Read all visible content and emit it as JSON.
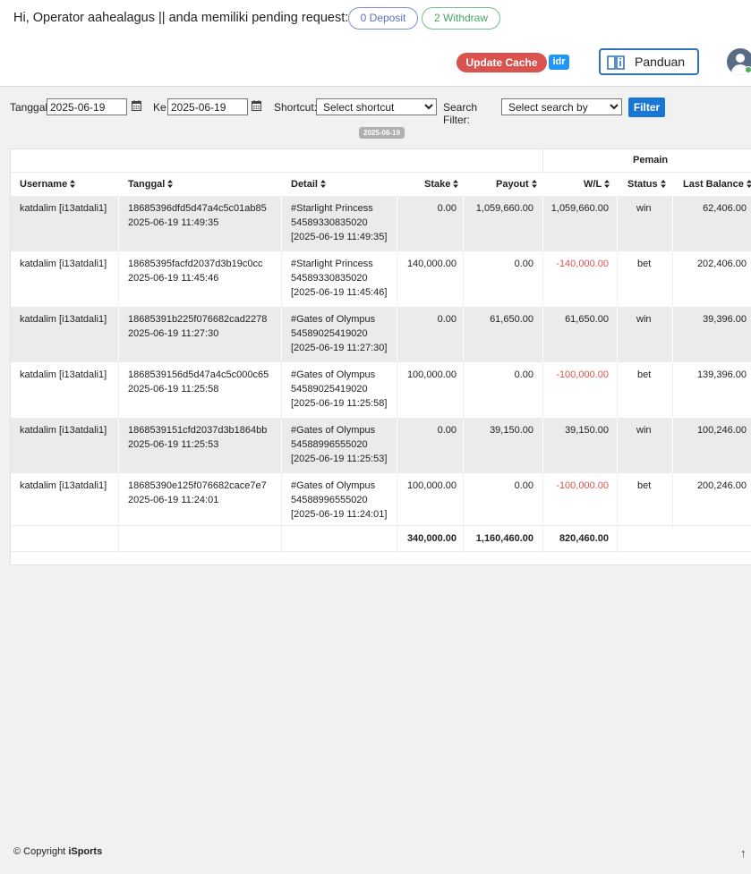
{
  "header": {
    "greeting": "Hi, Operator aahealagus || anda memiliki pending request:",
    "deposit_pill": "0 Deposit",
    "withdraw_pill": "2 Withdraw",
    "update_cache": "Update Cache",
    "currency_badge": "idr",
    "panduan": "Panduan"
  },
  "filters": {
    "date_from_label": "Tanggal",
    "date_from": "2025-06-19",
    "date_to_label": "Ke",
    "date_to": "2025-06-19",
    "shortcut_label": "Shortcut:",
    "shortcut_value": "Select shortcut",
    "search_label": "Search Filter:",
    "search_value": "Select search by",
    "filter_button": "Filter"
  },
  "date_chip": "2025-06-19",
  "table": {
    "group_label": "Pemain",
    "columns": {
      "username": "Username",
      "tanggal": "Tanggal",
      "detail": "Detail",
      "stake": "Stake",
      "payout": "Payout",
      "wl": "W/L",
      "status": "Status",
      "last_balance": "Last Balance"
    },
    "rows": [
      {
        "username": "katdalim [i13atdali1]",
        "tx_id": "18685396dfd5d47a4c5c01ab85",
        "datetime": "2025-06-19 11:49:35",
        "game": "#Starlight Princess",
        "round": "54589330835020",
        "round_time": "[2025-06-19 11:49:35]",
        "stake": "0.00",
        "payout": "1,059,660.00",
        "wl": "1,059,660.00",
        "wl_negative": false,
        "status": "win",
        "last_balance": "62,406.00"
      },
      {
        "username": "katdalim [i13atdali1]",
        "tx_id": "18685395facfd2037d3b19c0cc",
        "datetime": "2025-06-19 11:45:46",
        "game": "#Starlight Princess",
        "round": "54589330835020",
        "round_time": "[2025-06-19 11:45:46]",
        "stake": "140,000.00",
        "payout": "0.00",
        "wl": "-140,000.00",
        "wl_negative": true,
        "status": "bet",
        "last_balance": "202,406.00"
      },
      {
        "username": "katdalim [i13atdali1]",
        "tx_id": "18685391b225f076682cad2278",
        "datetime": "2025-06-19 11:27:30",
        "game": "#Gates of Olympus",
        "round": "54589025419020",
        "round_time": "[2025-06-19 11:27:30]",
        "stake": "0.00",
        "payout": "61,650.00",
        "wl": "61,650.00",
        "wl_negative": false,
        "status": "win",
        "last_balance": "39,396.00"
      },
      {
        "username": "katdalim [i13atdali1]",
        "tx_id": "1868539156d5d47a4c5c000c65",
        "datetime": "2025-06-19 11:25:58",
        "game": "#Gates of Olympus",
        "round": "54589025419020",
        "round_time": "[2025-06-19 11:25:58]",
        "stake": "100,000.00",
        "payout": "0.00",
        "wl": "-100,000.00",
        "wl_negative": true,
        "status": "bet",
        "last_balance": "139,396.00"
      },
      {
        "username": "katdalim [i13atdali1]",
        "tx_id": "1868539151cfd2037d3b1864bb",
        "datetime": "2025-06-19 11:25:53",
        "game": "#Gates of Olympus",
        "round": "54588996555020",
        "round_time": "[2025-06-19 11:25:53]",
        "stake": "0.00",
        "payout": "39,150.00",
        "wl": "39,150.00",
        "wl_negative": false,
        "status": "win",
        "last_balance": "100,246.00"
      },
      {
        "username": "katdalim [i13atdali1]",
        "tx_id": "18685390e125f076682cace7e7",
        "datetime": "2025-06-19 11:24:01",
        "game": "#Gates of Olympus",
        "round": "54588996555020",
        "round_time": "[2025-06-19 11:24:01]",
        "stake": "100,000.00",
        "payout": "0.00",
        "wl": "-100,000.00",
        "wl_negative": true,
        "status": "bet",
        "last_balance": "200,246.00"
      }
    ],
    "totals": {
      "stake": "340,000.00",
      "payout": "1,160,460.00",
      "wl": "820,460.00"
    }
  },
  "footer": {
    "copyright": "© Copyright",
    "brand": "iSports",
    "to_top": "↑"
  },
  "colors": {
    "accent": "#1976d2",
    "danger": "#d9534f",
    "negative_text": "#d9534f",
    "deposit": "#5b72c7",
    "withdraw": "#47a862"
  }
}
